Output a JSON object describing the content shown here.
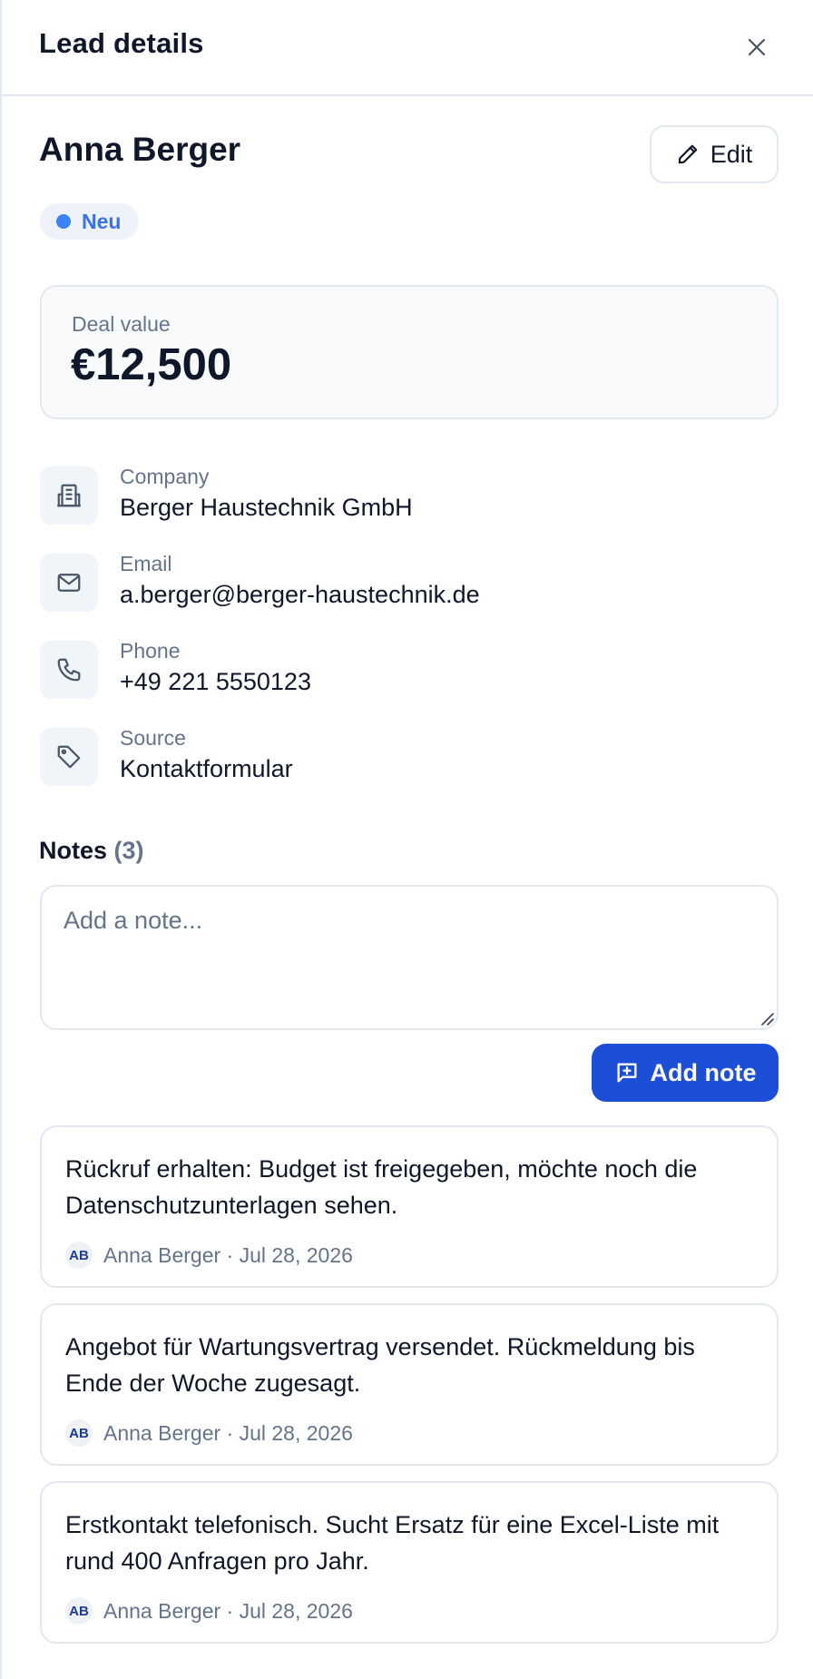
{
  "header": {
    "title": "Lead details"
  },
  "lead": {
    "name": "Anna Berger",
    "edit_label": "Edit",
    "status": "Neu"
  },
  "deal": {
    "label": "Deal value",
    "value": "€12,500"
  },
  "info": [
    {
      "label": "Company",
      "value": "Berger Haustechnik GmbH",
      "icon": "building-icon"
    },
    {
      "label": "Email",
      "value": "a.berger@berger-haustechnik.de",
      "icon": "mail-icon"
    },
    {
      "label": "Phone",
      "value": "+49 221 5550123",
      "icon": "phone-icon"
    },
    {
      "label": "Source",
      "value": "Kontaktformular",
      "icon": "tag-icon"
    }
  ],
  "notes": {
    "title": "Notes",
    "count": "(3)",
    "placeholder": "Add a note...",
    "add_label": "Add note",
    "items": [
      {
        "text": "Rückruf erhalten: Budget ist freigegeben, möchte noch die Datenschutzunterlagen sehen.",
        "initials": "AB",
        "meta": "Anna Berger · Jul 28, 2026"
      },
      {
        "text": "Angebot für Wartungsvertrag versendet. Rückmeldung bis Ende der Woche zugesagt.",
        "initials": "AB",
        "meta": "Anna Berger · Jul 28, 2026"
      },
      {
        "text": "Erstkontakt telefonisch. Sucht Ersatz für eine Excel-Liste mit rund 400 Anfragen pro Jahr.",
        "initials": "AB",
        "meta": "Anna Berger · Jul 28, 2026"
      }
    ]
  },
  "colors": {
    "accent": "#1d4ed8",
    "status": "#3b82f6",
    "muted": "#64748b",
    "border": "#e2e8f0"
  }
}
